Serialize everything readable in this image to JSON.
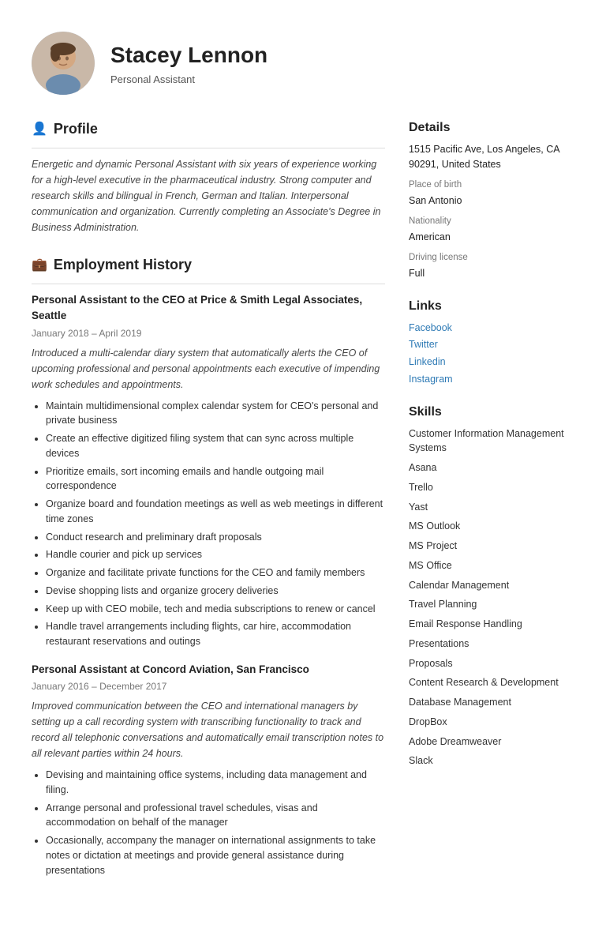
{
  "header": {
    "name": "Stacey Lennon",
    "title": "Personal Assistant"
  },
  "profile": {
    "section_title": "Profile",
    "text": "Energetic and dynamic Personal Assistant with six years of experience working for a high-level executive in the pharmaceutical industry. Strong computer and research skills and bilingual in French, German and Italian. Interpersonal communication and organization. Currently completing an Associate's Degree in Business Administration."
  },
  "employment": {
    "section_title": "Employment History",
    "jobs": [
      {
        "title": "Personal Assistant to the CEO at Price & Smith Legal Associates, Seattle",
        "dates": "January 2018  –  April 2019",
        "description": "Introduced a multi-calendar diary system that automatically alerts the CEO of upcoming professional and personal appointments each executive of impending work schedules and appointments.",
        "bullets": [
          "Maintain multidimensional complex calendar system for CEO's personal and private business",
          "Create an effective digitized filing system that can sync across multiple devices",
          "Prioritize emails, sort incoming emails and handle outgoing mail correspondence",
          "Organize board and foundation meetings as well as web meetings in different time zones",
          "Conduct research and preliminary draft proposals",
          "Handle courier and pick up services",
          "Organize and facilitate private functions for the CEO and family members",
          "Devise shopping lists and organize grocery deliveries",
          "Keep up with CEO mobile, tech and media subscriptions to renew or cancel",
          "Handle travel arrangements including flights, car hire, accommodation restaurant reservations and outings"
        ]
      },
      {
        "title": "Personal Assistant at Concord Aviation, San Francisco",
        "dates": "January 2016  –  December 2017",
        "description": "Improved communication between the CEO and international managers by setting up a call recording system with transcribing functionality to track and record all telephonic conversations and automatically email transcription notes to all relevant parties within 24 hours.",
        "bullets": [
          "Devising and maintaining office systems, including data management and filing.",
          "Arrange personal and professional travel schedules, visas and accommodation on behalf of the manager",
          "Occasionally, accompany the manager  on international assignments to take notes or dictation at meetings and provide general assistance during presentations"
        ]
      }
    ]
  },
  "details": {
    "section_title": "Details",
    "address": "1515 Pacific Ave, Los Angeles, CA 90291, United States",
    "place_of_birth_label": "Place of birth",
    "place_of_birth": "San Antonio",
    "nationality_label": "Nationality",
    "nationality": "American",
    "driving_license_label": "Driving license",
    "driving_license": "Full"
  },
  "links": {
    "section_title": "Links",
    "items": [
      {
        "label": "Facebook",
        "url": "#"
      },
      {
        "label": "Twitter",
        "url": "#"
      },
      {
        "label": "Linkedin",
        "url": "#"
      },
      {
        "label": "Instagram",
        "url": "#"
      }
    ]
  },
  "skills": {
    "section_title": "Skills",
    "items": [
      "Customer Information Management Systems",
      "Asana",
      "Trello",
      "Yast",
      "MS Outlook",
      "MS Project",
      "MS Office",
      "Calendar Management",
      "Travel Planning",
      "Email Response Handling",
      "Presentations",
      "Proposals",
      "Content Research & Development",
      "Database Management",
      "DropBox",
      "Adobe Dreamweaver",
      "Slack"
    ]
  }
}
